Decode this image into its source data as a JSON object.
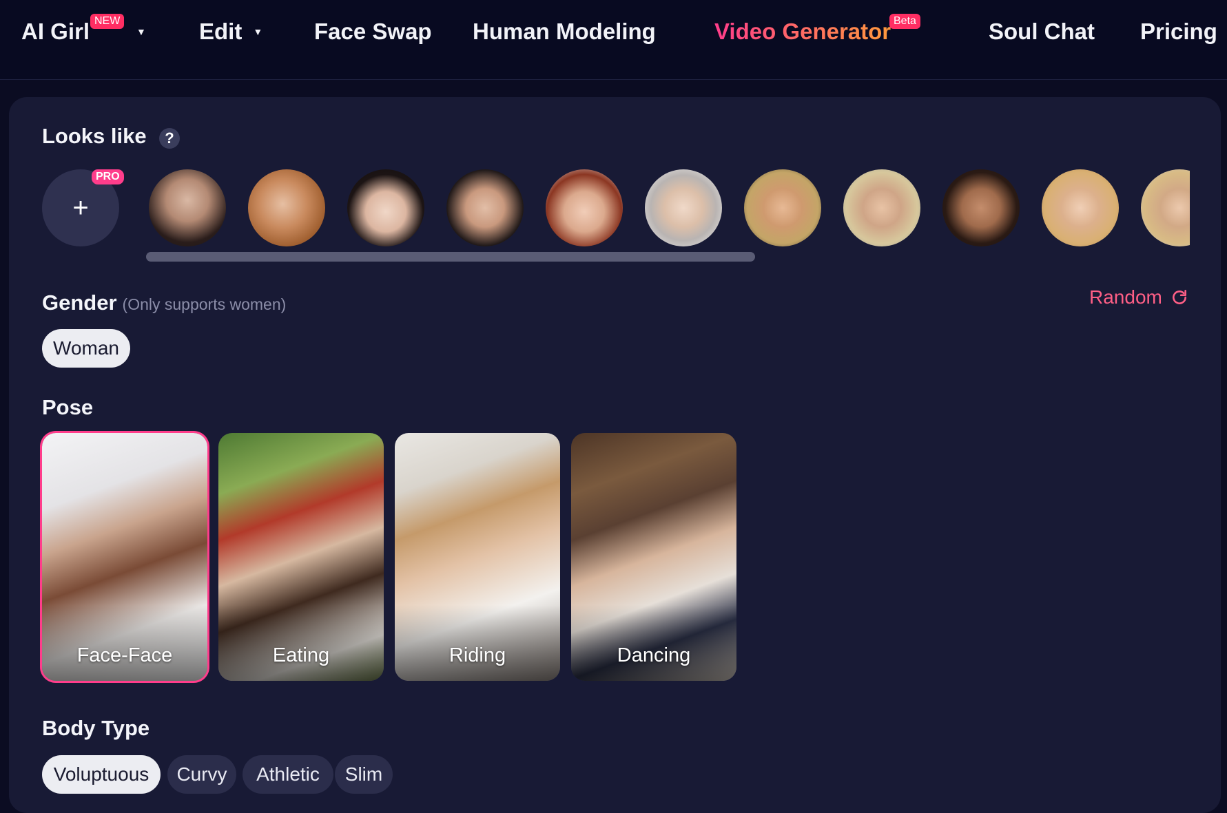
{
  "nav": {
    "items": [
      {
        "label": "AI Girl",
        "badge": "NEW",
        "has_caret": true
      },
      {
        "label": "Edit",
        "has_caret": true
      },
      {
        "label": "Face Swap"
      },
      {
        "label": "Human Modeling"
      },
      {
        "label": "Video Generator",
        "badge": "Beta",
        "active": true
      },
      {
        "label": "Soul Chat"
      },
      {
        "label": "Pricing"
      }
    ],
    "accent_gradient": [
      "#ff3d8b",
      "#ff9a3c"
    ]
  },
  "looks_like": {
    "title": "Looks like",
    "help_icon": "question-icon",
    "add_icon": "plus-icon",
    "pro_badge": "PRO",
    "avatar_count": 11
  },
  "gender": {
    "title": "Gender",
    "note": "(Only supports women)",
    "random_label": "Random",
    "random_icon": "refresh-icon",
    "options": [
      {
        "label": "Woman",
        "selected": true
      }
    ]
  },
  "pose": {
    "title": "Pose",
    "options": [
      {
        "label": "Face-Face",
        "selected": true
      },
      {
        "label": "Eating"
      },
      {
        "label": "Riding"
      },
      {
        "label": "Dancing"
      }
    ]
  },
  "body_type": {
    "title": "Body Type",
    "options": [
      {
        "label": "Voluptuous",
        "selected": true
      },
      {
        "label": "Curvy"
      },
      {
        "label": "Athletic"
      },
      {
        "label": "Slim"
      }
    ]
  },
  "colors": {
    "page_bg": "#0b0c22",
    "panel_bg": "#181a35",
    "chip_bg": "#2b2d4b",
    "chip_selected_bg": "#ecedf2",
    "random_color": "#ff5f86",
    "badge_color": "#ff2e63"
  }
}
